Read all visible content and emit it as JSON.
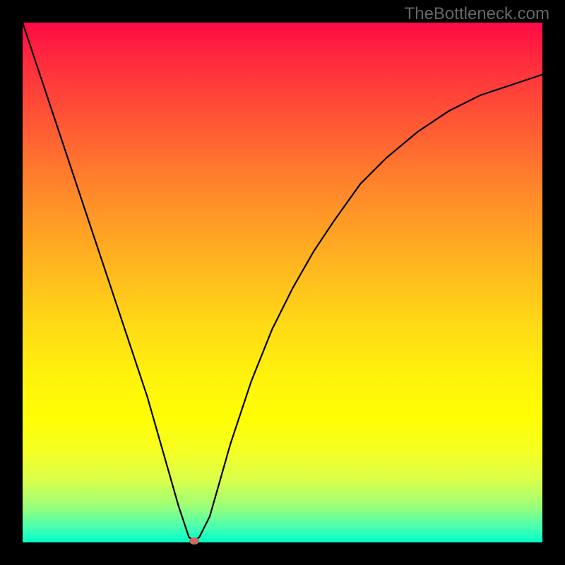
{
  "watermark": "TheBottleneck.com",
  "chart_data": {
    "type": "line",
    "title": "",
    "xlabel": "",
    "ylabel": "",
    "xlim": [
      0,
      100
    ],
    "ylim": [
      0,
      100
    ],
    "series": [
      {
        "name": "curve",
        "x": [
          0,
          4,
          8,
          12,
          16,
          20,
          24,
          28,
          30,
          32,
          33,
          34,
          36,
          38,
          40,
          44,
          48,
          52,
          56,
          60,
          65,
          70,
          76,
          82,
          88,
          94,
          100
        ],
        "y": [
          100,
          88,
          76,
          64,
          52,
          40,
          28,
          14,
          7,
          1,
          0.3,
          1,
          5,
          12,
          19,
          31,
          41,
          49,
          56,
          62,
          69,
          74,
          79,
          83,
          86,
          88,
          90
        ]
      }
    ],
    "marker": {
      "x": 33,
      "y": 0.3
    },
    "background_gradient": {
      "top": "#ff0a46",
      "mid": "#fffe04",
      "bottom": "#00ffc8"
    }
  }
}
